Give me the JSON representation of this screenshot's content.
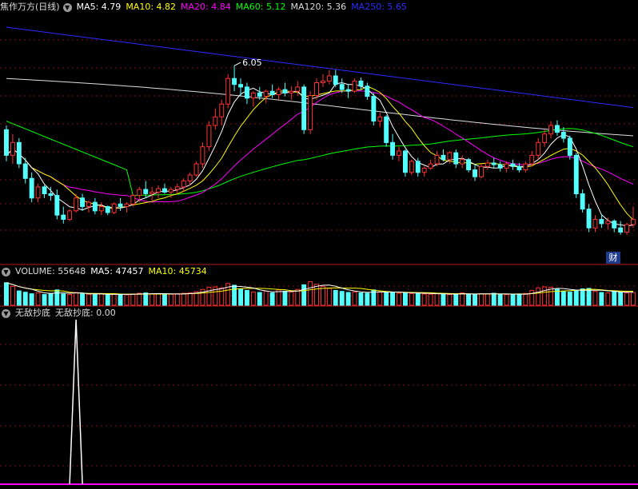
{
  "main_legend": {
    "title": "焦作万方(日线)",
    "ma": [
      {
        "label": "MA5: 4.79",
        "color": "#ffffff"
      },
      {
        "label": "MA10: 4.82",
        "color": "#ffff00"
      },
      {
        "label": "MA20: 4.84",
        "color": "#ff00ff"
      },
      {
        "label": "MA60: 5.12",
        "color": "#00ff00"
      },
      {
        "label": "MA120: 5.36",
        "color": "#dddddd"
      },
      {
        "label": "MA250: 5.65",
        "color": "#2b2bff"
      }
    ]
  },
  "volume_legend": {
    "title": "VOLUME: 55648",
    "ma5": "MA5: 47457",
    "ma10": "MA10: 45734"
  },
  "indicator_legend": {
    "title": "无敌抄底",
    "value": "无敌抄底: 0.00"
  },
  "badge": "财",
  "colors": {
    "up": "#ff3232",
    "down": "#54ffff",
    "ma5": "#ffffff",
    "ma10": "#ffff00",
    "ma20": "#ff00ff",
    "ma60": "#00ff00",
    "ma120": "#dddddd",
    "ma250": "#2b2bff",
    "grid": "#7a1010",
    "indicator_base": "#ff00ff"
  },
  "chart_data": [
    {
      "type": "candlestick",
      "title": "焦作万方(日线)",
      "max_annotation": "6.05",
      "ylim": [
        3.8,
        6.7
      ],
      "grid": true,
      "ohlc": [
        [
          5.35,
          5.4,
          4.98,
          5.05
        ],
        [
          5.05,
          5.3,
          4.95,
          5.2
        ],
        [
          5.2,
          5.25,
          4.9,
          4.95
        ],
        [
          4.95,
          5.02,
          4.72,
          4.78
        ],
        [
          4.78,
          4.85,
          4.5,
          4.55
        ],
        [
          4.55,
          4.72,
          4.5,
          4.68
        ],
        [
          4.68,
          4.7,
          4.55,
          4.6
        ],
        [
          4.6,
          4.68,
          4.52,
          4.58
        ],
        [
          4.58,
          4.65,
          4.3,
          4.35
        ],
        [
          4.35,
          4.45,
          4.25,
          4.3
        ],
        [
          4.3,
          4.42,
          4.28,
          4.4
        ],
        [
          4.4,
          4.6,
          4.38,
          4.55
        ],
        [
          4.55,
          4.6,
          4.4,
          4.45
        ],
        [
          4.45,
          4.52,
          4.38,
          4.5
        ],
        [
          4.5,
          4.55,
          4.36,
          4.4
        ],
        [
          4.4,
          4.5,
          4.35,
          4.45
        ],
        [
          4.45,
          4.46,
          4.35,
          4.38
        ],
        [
          4.38,
          4.5,
          4.36,
          4.48
        ],
        [
          4.48,
          4.55,
          4.4,
          4.45
        ],
        [
          4.45,
          4.5,
          4.38,
          4.48
        ],
        [
          4.48,
          4.6,
          4.45,
          4.58
        ],
        [
          4.58,
          4.68,
          4.5,
          4.65
        ],
        [
          4.65,
          4.75,
          4.55,
          4.6
        ],
        [
          4.6,
          4.68,
          4.52,
          4.62
        ],
        [
          4.62,
          4.7,
          4.55,
          4.66
        ],
        [
          4.66,
          4.72,
          4.6,
          4.62
        ],
        [
          4.62,
          4.68,
          4.55,
          4.65
        ],
        [
          4.65,
          4.72,
          4.6,
          4.68
        ],
        [
          4.68,
          4.78,
          4.62,
          4.75
        ],
        [
          4.75,
          4.85,
          4.7,
          4.82
        ],
        [
          4.82,
          4.98,
          4.8,
          4.95
        ],
        [
          4.95,
          5.2,
          4.9,
          5.15
        ],
        [
          5.15,
          5.45,
          5.1,
          5.4
        ],
        [
          5.4,
          5.6,
          5.35,
          5.5
        ],
        [
          5.5,
          5.7,
          5.4,
          5.65
        ],
        [
          5.65,
          6.0,
          5.6,
          5.95
        ],
        [
          5.95,
          6.1,
          5.8,
          5.88
        ],
        [
          5.88,
          5.95,
          5.75,
          5.85
        ],
        [
          5.85,
          5.9,
          5.65,
          5.72
        ],
        [
          5.72,
          5.8,
          5.62,
          5.78
        ],
        [
          5.78,
          5.85,
          5.7,
          5.74
        ],
        [
          5.74,
          5.82,
          5.66,
          5.8
        ],
        [
          5.8,
          5.88,
          5.72,
          5.76
        ],
        [
          5.76,
          5.85,
          5.7,
          5.82
        ],
        [
          5.82,
          5.9,
          5.74,
          5.78
        ],
        [
          5.78,
          5.86,
          5.7,
          5.8
        ],
        [
          5.8,
          5.92,
          5.75,
          5.85
        ],
        [
          5.85,
          5.88,
          5.3,
          5.35
        ],
        [
          5.35,
          5.8,
          5.3,
          5.75
        ],
        [
          5.75,
          5.95,
          5.7,
          5.9
        ],
        [
          5.9,
          6.0,
          5.85,
          5.92
        ],
        [
          5.92,
          6.05,
          5.88,
          5.98
        ],
        [
          5.98,
          6.05,
          5.85,
          5.88
        ],
        [
          5.88,
          5.95,
          5.78,
          5.82
        ],
        [
          5.82,
          5.88,
          5.72,
          5.8
        ],
        [
          5.8,
          5.95,
          5.78,
          5.92
        ],
        [
          5.92,
          5.96,
          5.82,
          5.86
        ],
        [
          5.86,
          5.9,
          5.7,
          5.74
        ],
        [
          5.74,
          5.78,
          5.4,
          5.45
        ],
        [
          5.45,
          5.55,
          5.38,
          5.5
        ],
        [
          5.5,
          5.52,
          5.15,
          5.2
        ],
        [
          5.2,
          5.3,
          5.0,
          5.05
        ],
        [
          5.05,
          5.15,
          4.98,
          5.1
        ],
        [
          5.1,
          5.12,
          4.8,
          4.85
        ],
        [
          4.85,
          5.0,
          4.82,
          4.98
        ],
        [
          4.98,
          5.02,
          4.8,
          4.85
        ],
        [
          4.85,
          4.92,
          4.8,
          4.9
        ],
        [
          4.9,
          5.0,
          4.88,
          4.95
        ],
        [
          4.95,
          5.1,
          4.92,
          5.05
        ],
        [
          5.05,
          5.12,
          4.98,
          5.0
        ],
        [
          5.0,
          5.1,
          4.95,
          5.08
        ],
        [
          5.08,
          5.12,
          4.9,
          4.95
        ],
        [
          4.95,
          5.05,
          4.9,
          5.0
        ],
        [
          5.0,
          5.02,
          4.85,
          4.88
        ],
        [
          4.88,
          4.95,
          4.75,
          4.8
        ],
        [
          4.8,
          4.95,
          4.78,
          4.92
        ],
        [
          4.92,
          5.0,
          4.88,
          4.96
        ],
        [
          4.96,
          5.02,
          4.9,
          4.94
        ],
        [
          4.94,
          4.98,
          4.86,
          4.9
        ],
        [
          4.9,
          4.98,
          4.85,
          4.95
        ],
        [
          4.95,
          5.0,
          4.88,
          4.92
        ],
        [
          4.92,
          4.96,
          4.85,
          4.88
        ],
        [
          4.88,
          4.98,
          4.85,
          4.95
        ],
        [
          4.95,
          5.1,
          4.92,
          5.05
        ],
        [
          5.05,
          5.25,
          5.0,
          5.2
        ],
        [
          5.2,
          5.35,
          5.15,
          5.3
        ],
        [
          5.3,
          5.45,
          5.25,
          5.4
        ],
        [
          5.4,
          5.46,
          5.28,
          5.32
        ],
        [
          5.32,
          5.38,
          5.2,
          5.25
        ],
        [
          5.25,
          5.28,
          5.0,
          5.05
        ],
        [
          5.05,
          5.08,
          4.55,
          4.6
        ],
        [
          4.6,
          4.65,
          4.38,
          4.42
        ],
        [
          4.42,
          4.48,
          4.15,
          4.2
        ],
        [
          4.2,
          4.35,
          4.15,
          4.3
        ],
        [
          4.3,
          4.36,
          4.2,
          4.25
        ],
        [
          4.25,
          4.32,
          4.18,
          4.28
        ],
        [
          4.28,
          4.3,
          4.15,
          4.2
        ],
        [
          4.2,
          4.28,
          4.12,
          4.15
        ],
        [
          4.15,
          4.26,
          4.12,
          4.24
        ],
        [
          4.24,
          4.45,
          4.2,
          4.3
        ]
      ]
    },
    {
      "type": "bar",
      "title": "VOLUME: 55648",
      "values": [
        88,
        74,
        56,
        51,
        45,
        48,
        42,
        46,
        60,
        44,
        42,
        50,
        44,
        43,
        41,
        44,
        40,
        45,
        43,
        41,
        44,
        47,
        48,
        45,
        44,
        42,
        43,
        45,
        47,
        49,
        53,
        62,
        70,
        72,
        68,
        85,
        78,
        64,
        58,
        52,
        50,
        55,
        48,
        60,
        55,
        52,
        62,
        80,
        92,
        82,
        74,
        66,
        58,
        54,
        50,
        52,
        48,
        47,
        60,
        52,
        50,
        49,
        47,
        50,
        46,
        47,
        44,
        43,
        45,
        44,
        42,
        43,
        48,
        44,
        42,
        45,
        44,
        47,
        43,
        42,
        41,
        44,
        46,
        58,
        68,
        72,
        70,
        62,
        55,
        52,
        58,
        64,
        66,
        54,
        50,
        48,
        56,
        52,
        48,
        50
      ],
      "ylim": [
        0,
        100
      ]
    },
    {
      "type": "line",
      "title": "无敌抄底",
      "spike_index": 11,
      "spike_value": 100,
      "baseline": 0,
      "ylim": [
        0,
        100
      ]
    }
  ]
}
